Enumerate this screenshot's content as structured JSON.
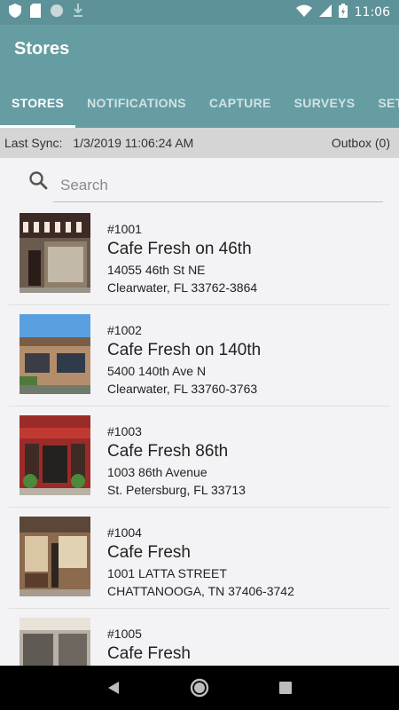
{
  "status_bar": {
    "time": "11:06"
  },
  "app": {
    "title": "Stores"
  },
  "tabs": [
    {
      "label": "STORES",
      "active": true
    },
    {
      "label": "NOTIFICATIONS",
      "active": false
    },
    {
      "label": "CAPTURE",
      "active": false
    },
    {
      "label": "SURVEYS",
      "active": false
    },
    {
      "label": "SETTI",
      "active": false
    }
  ],
  "sync": {
    "label": "Last Sync:",
    "value": "1/3/2019 11:06:24 AM",
    "outbox": "Outbox (0)"
  },
  "search": {
    "placeholder": "Search",
    "value": ""
  },
  "stores": [
    {
      "number": "#1001",
      "name": "Cafe Fresh on 46th",
      "address1": "14055 46th St NE",
      "address2": "Clearwater, FL 33762-3864"
    },
    {
      "number": "#1002",
      "name": "Cafe Fresh on 140th",
      "address1": "5400 140th Ave N",
      "address2": "Clearwater, FL 33760-3763"
    },
    {
      "number": "#1003",
      "name": "Cafe Fresh 86th",
      "address1": "1003 86th Avenue",
      "address2": "St. Petersburg, FL 33713"
    },
    {
      "number": "#1004",
      "name": "Cafe Fresh",
      "address1": "1001 LATTA STREET",
      "address2": "CHATTANOOGA, TN 37406-3742"
    },
    {
      "number": "#1005",
      "name": "Cafe Fresh",
      "address1": "",
      "address2": ""
    }
  ],
  "colors": {
    "app_bar": "#669da3",
    "status_bar": "#5c9298",
    "sync_bar": "#d5d5d5"
  }
}
